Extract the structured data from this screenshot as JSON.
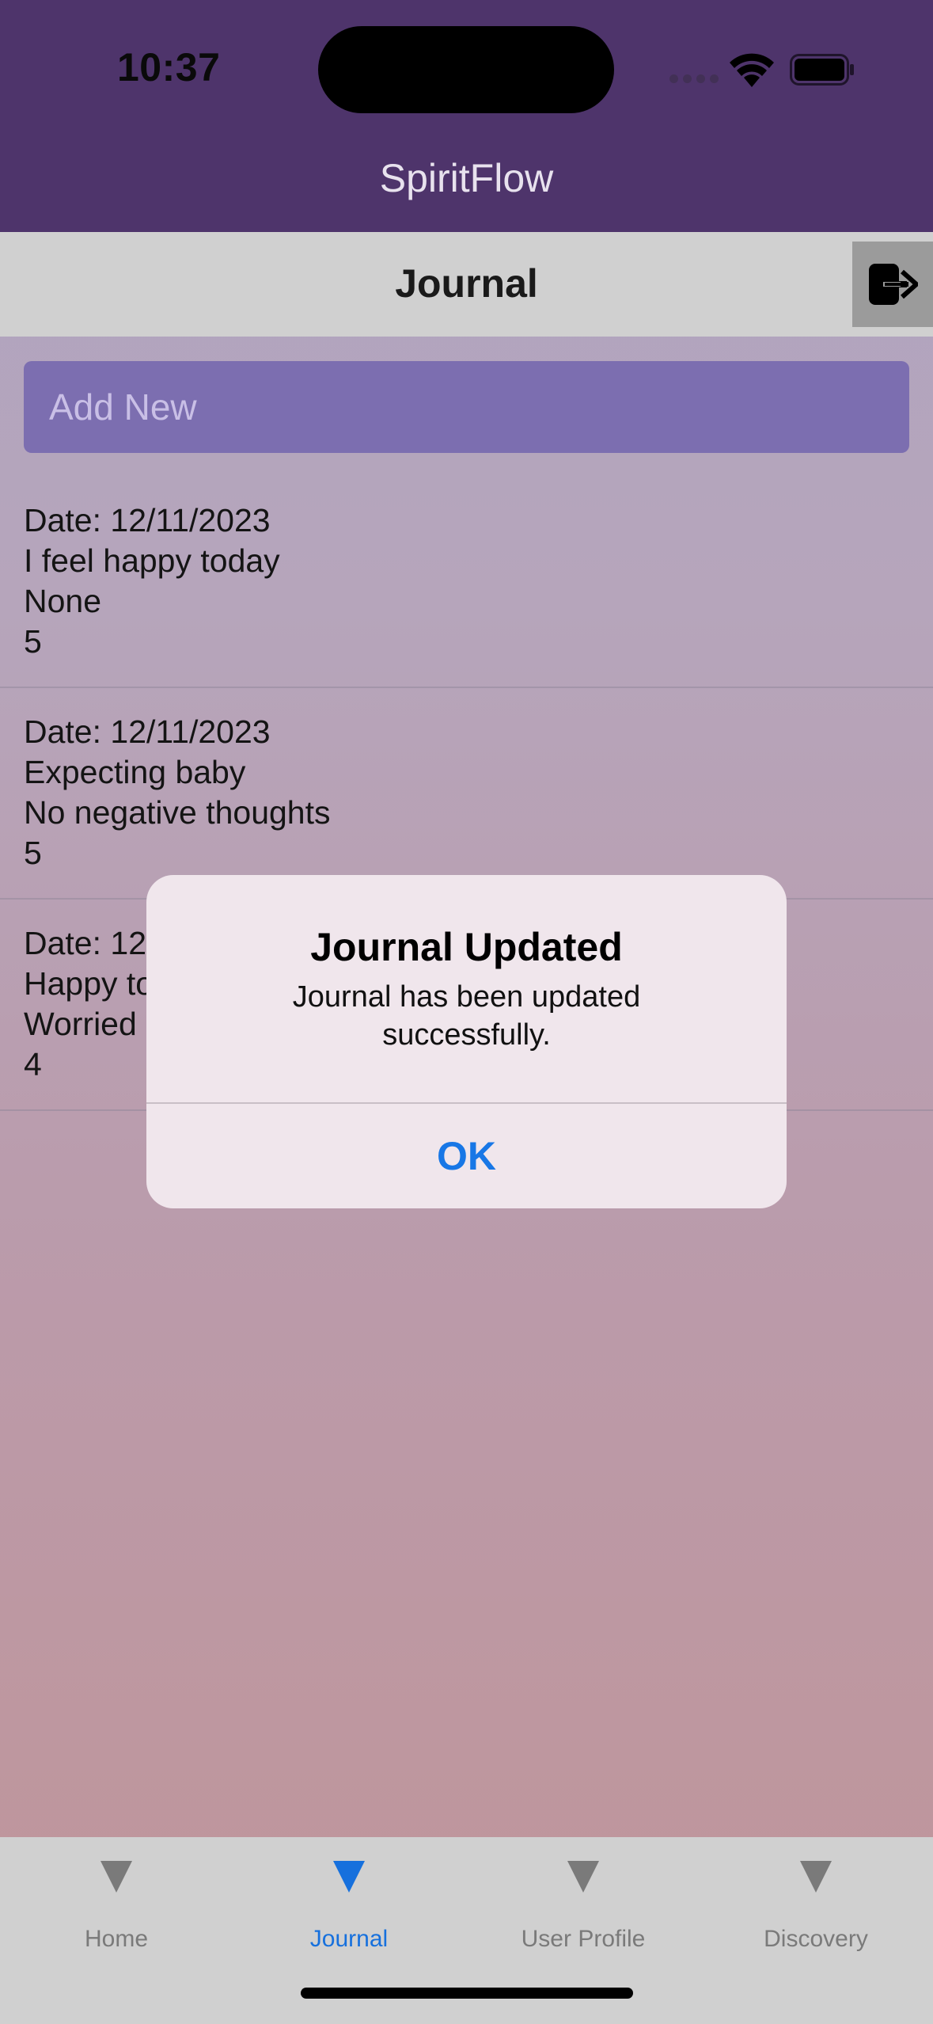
{
  "status_bar": {
    "time": "10:37"
  },
  "app": {
    "title": "SpiritFlow"
  },
  "header": {
    "title": "Journal",
    "logout_icon": "logout-arrow-icon"
  },
  "add_new": {
    "placeholder": "Add New"
  },
  "entries": [
    {
      "date": "Date: 12/11/2023",
      "text": "I feel happy today",
      "thoughts": "None",
      "rating": "5"
    },
    {
      "date": "Date: 12/11/2023",
      "text": "Expecting baby",
      "thoughts": "No negative thoughts",
      "rating": "5"
    },
    {
      "date": "Date: 12",
      "text": "Happy to",
      "thoughts": "Worried",
      "rating": "4"
    }
  ],
  "alert": {
    "title": "Journal Updated",
    "message": "Journal has been updated successfully.",
    "ok_label": "OK"
  },
  "tabs": [
    {
      "label": "Home",
      "icon": "triangle-down-icon",
      "active": false
    },
    {
      "label": "Journal",
      "icon": "triangle-down-icon",
      "active": true
    },
    {
      "label": "User Profile",
      "icon": "triangle-down-icon",
      "active": false
    },
    {
      "label": "Discovery",
      "icon": "triangle-down-icon",
      "active": false
    }
  ],
  "colors": {
    "top_bar": "#4e346b",
    "add_new_bg": "#7c6eb0",
    "accent": "#1670dd",
    "alert_ok": "#1877e6"
  }
}
